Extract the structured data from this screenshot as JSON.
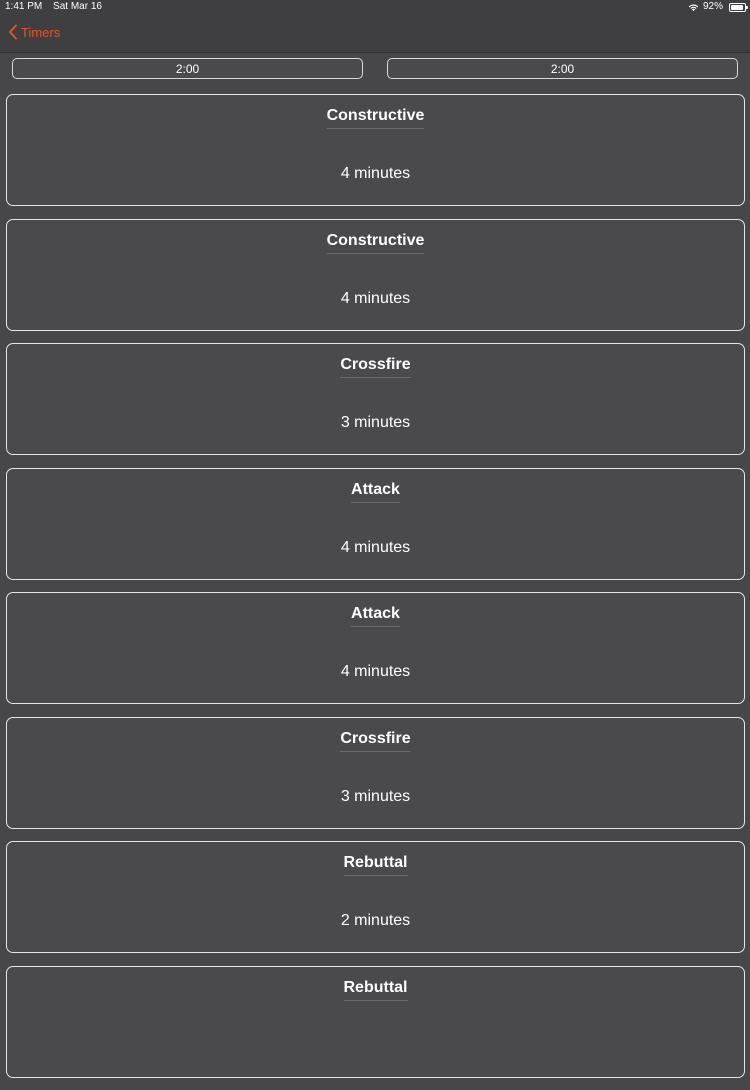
{
  "status_bar": {
    "time": "1:41 PM",
    "date": "Sat Mar 16",
    "battery_percent": "92%",
    "battery_level": 0.92
  },
  "nav": {
    "back_label": "Timers"
  },
  "prep_timers": {
    "left": "2:00",
    "right": "2:00"
  },
  "speeches": [
    {
      "title": "Constructive",
      "duration": "4 minutes"
    },
    {
      "title": "Constructive",
      "duration": "4 minutes"
    },
    {
      "title": "Crossfire",
      "duration": "3 minutes"
    },
    {
      "title": "Attack",
      "duration": "4 minutes"
    },
    {
      "title": "Attack",
      "duration": "4 minutes"
    },
    {
      "title": "Crossfire",
      "duration": "3 minutes"
    },
    {
      "title": "Rebuttal",
      "duration": "2 minutes"
    },
    {
      "title": "Rebuttal",
      "duration": ""
    }
  ],
  "colors": {
    "accent": "#e0552e",
    "background": "#474648",
    "card_border": "#e6e6e6"
  },
  "icons": {
    "back": "chevron-left-icon",
    "wifi": "wifi-icon",
    "battery": "battery-icon"
  }
}
